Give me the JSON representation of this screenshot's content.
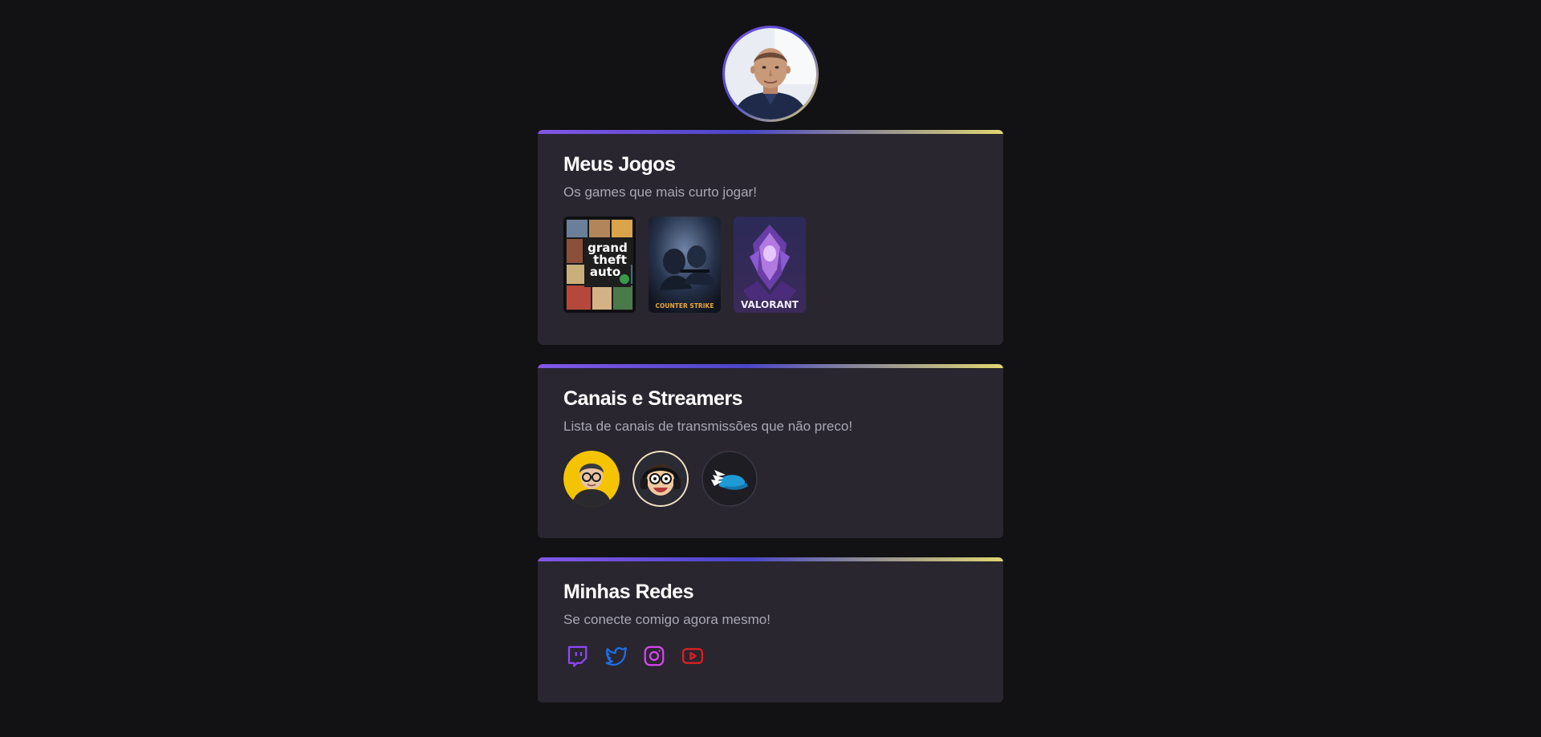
{
  "games_card": {
    "title": "Meus Jogos",
    "subtitle": "Os games que mais curto jogar!",
    "games": [
      {
        "name": "Grand Theft Auto V",
        "icon": "gta-v-cover"
      },
      {
        "name": "Counter-Strike",
        "icon": "counter-strike-cover",
        "logo": "COUNTER STRIKE"
      },
      {
        "name": "Valorant",
        "icon": "valorant-cover",
        "logo": "VALORANT"
      }
    ],
    "gta_logo_lines": [
      "grand",
      "theft",
      "auto"
    ]
  },
  "channels_card": {
    "title": "Canais e Streamers",
    "subtitle": "Lista de canais de transmissões que não preco!",
    "channels": [
      {
        "icon": "streamer-avatar-glasses"
      },
      {
        "icon": "streamer-avatar-headphones"
      },
      {
        "icon": "streamer-avatar-winged-helmet"
      }
    ]
  },
  "socials_card": {
    "title": "Minhas Redes",
    "subtitle": "Se conecte comigo agora mesmo!",
    "links": [
      {
        "icon": "twitch-icon",
        "color": "#9146ff"
      },
      {
        "icon": "twitter-icon",
        "color": "#1d6fe8"
      },
      {
        "icon": "instagram-icon",
        "color": "#d946ef"
      },
      {
        "icon": "youtube-icon",
        "color": "#e11d1d"
      }
    ]
  },
  "colors": {
    "background": "#121214",
    "card": "#29262f",
    "accent_start": "#8257e6",
    "accent_end": "#e1d771"
  }
}
